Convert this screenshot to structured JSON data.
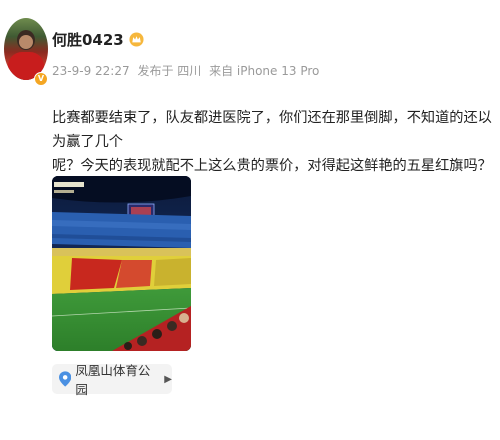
{
  "post": {
    "username": "何胜0423",
    "time": "23-9-9 22:27",
    "published_in": "发布于 四川",
    "device": "来自 iPhone 13 Pro",
    "text_line1": "比赛都要结束了，队友都进医院了，你们还在那里倒脚，不知道的还以为赢了几个",
    "text_line2": "呢？今天的表现就配不上这么贵的票价，对得起这鲜艳的五星红旗吗？",
    "location": "凤凰山体育公园"
  },
  "colors": {
    "location_pin": "#4a90e2",
    "badge": "#f4a623"
  }
}
